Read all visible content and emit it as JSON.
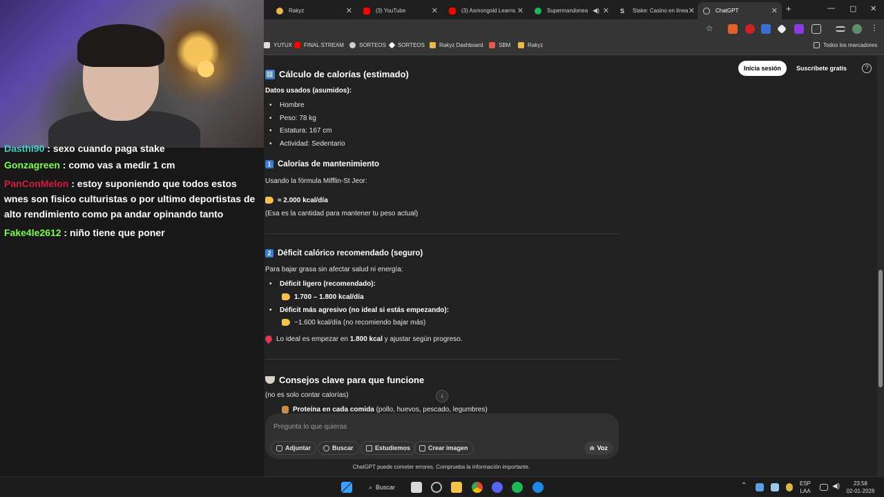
{
  "stream": {
    "chat": [
      {
        "user": "Dasthi90",
        "text": "sexo cuando paga stake",
        "color": "#3fd1c4"
      },
      {
        "user": "Gonzagreen",
        "text": "como vas a medir 1 cm",
        "color": "#7cfc52"
      },
      {
        "user": "PanConMelon",
        "text": "estoy suponiendo que todos estos wnes son fisico culturistas o por ultimo deportistas de alto rendimiento como pa andar opinando tanto",
        "color": "#d81b3c"
      },
      {
        "user": "Fake4le2612",
        "text": "niño tiene que poner",
        "color": "#7cfc52"
      }
    ],
    "separator": ":"
  },
  "browser": {
    "tabs": [
      {
        "label": "Rakyz",
        "icon_color": "#e8b84a"
      },
      {
        "label": "(3) YouTube",
        "icon_color": "#ff0000"
      },
      {
        "label": "(3) Asmongold Learns",
        "icon_color": "#ff0000"
      },
      {
        "label": "Supermandonea",
        "icon_color": "#1db954"
      },
      {
        "label": "Stake: Casino en línea",
        "icon_color": "#cfcfcf"
      },
      {
        "label": "ChatGPT",
        "icon_color": "#cfcfcf"
      }
    ],
    "tab_close": "✕",
    "new_tab": "+",
    "window": {
      "minimize": "—",
      "maximize": "▢",
      "close": "✕"
    },
    "bookmarks": [
      {
        "label": "YUTUX",
        "icon_color": "#dddddd"
      },
      {
        "label": "FINAL STREAM",
        "icon_color": "#ff0000"
      },
      {
        "label": "SORTEOS",
        "icon_color": "#cfcfcf"
      },
      {
        "label": "SORTEOS",
        "icon_color": "#ffffff"
      },
      {
        "label": "Rakyz Dashboard",
        "icon_color": "#e8b84a"
      },
      {
        "label": "SBM",
        "icon_color": "#e85a4a"
      },
      {
        "label": "Rakyz",
        "icon_color": "#e8b84a"
      }
    ],
    "all_bookmarks": "Todos los marcadores"
  },
  "chatgpt": {
    "login_label": "Inicia sesión",
    "subscribe_label": "Suscríbete gratis",
    "help_label": "?",
    "section1_title": "Cálculo de calorías (estimado)",
    "section1_emoji": "🔢",
    "data_label": "Datos usados (asumidos):",
    "data_items": [
      "Hombre",
      "Peso: 78 kg",
      "Estatura: 167 cm",
      "Actividad: Sedentario"
    ],
    "maint_num": "1",
    "maint_title": "Calorías de mantenimiento",
    "maint_formula": "Usando la fórmula Mifflin-St Jeor:",
    "maint_value": "≈ 2.000 kcal/día",
    "maint_note": "(Esa es la cantidad para mantener tu peso actual)",
    "deficit_num": "2",
    "deficit_title": "Déficit calórico recomendado (seguro)",
    "deficit_intro": "Para bajar grasa sin afectar salud ni energía:",
    "deficit_light_label": "Déficit ligero (recomendado):",
    "deficit_light_value": "1.700 – 1.800 kcal/día",
    "deficit_aggr_label": "Déficit más agresivo (no ideal si estás empezando):",
    "deficit_aggr_value": "~1.600 kcal/día (no recomiendo bajar más)",
    "ideal_pre": "Lo ideal es empezar en ",
    "ideal_bold": "1.800 kcal",
    "ideal_post": " y ajustar según progreso.",
    "tips_title": "Consejos clave para que funcione",
    "tips_note": "(no es solo contar calorías)",
    "tip1_bold": "Proteína en cada comida",
    "tip1_rest": " (pollo, huevos, pescado, legumbres)",
    "scroll_down": "↓",
    "composer_placeholder": "Pregunta lo que quieras",
    "composer_buttons": [
      "Adjuntar",
      "Buscar",
      "Estudiemos",
      "Crear imagen"
    ],
    "voice_label": "Voz",
    "disclaimer": "ChatGPT puede cometer errores. Comprueba la información importante."
  },
  "taskbar": {
    "search_label": "Buscar",
    "lang_top": "ESP",
    "lang_bottom": "LAA",
    "time": "23:58",
    "date": "02-01-2026"
  }
}
